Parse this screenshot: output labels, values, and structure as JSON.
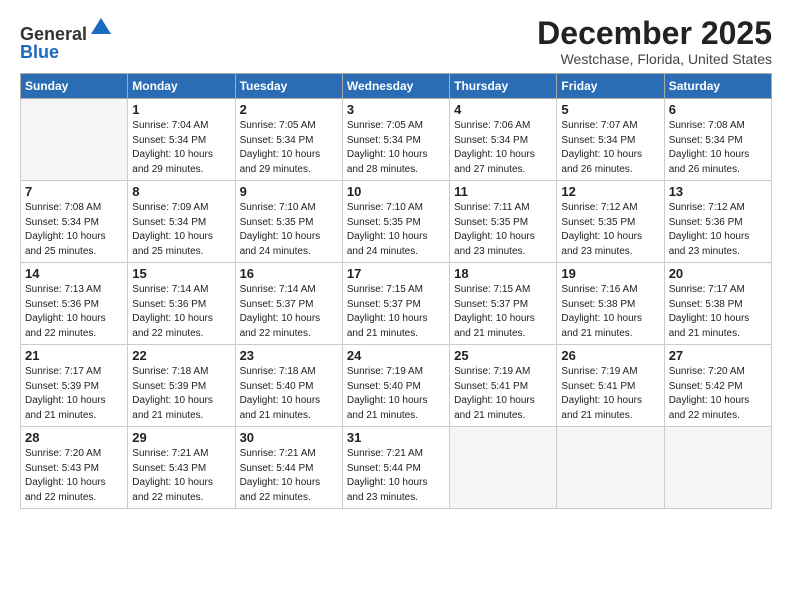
{
  "logo": {
    "general": "General",
    "blue": "Blue"
  },
  "header": {
    "month": "December 2025",
    "location": "Westchase, Florida, United States"
  },
  "weekdays": [
    "Sunday",
    "Monday",
    "Tuesday",
    "Wednesday",
    "Thursday",
    "Friday",
    "Saturday"
  ],
  "weeks": [
    [
      {
        "day": "",
        "empty": true
      },
      {
        "day": "1",
        "sunrise": "7:04 AM",
        "sunset": "5:34 PM",
        "daylight": "10 hours and 29 minutes."
      },
      {
        "day": "2",
        "sunrise": "7:05 AM",
        "sunset": "5:34 PM",
        "daylight": "10 hours and 29 minutes."
      },
      {
        "day": "3",
        "sunrise": "7:05 AM",
        "sunset": "5:34 PM",
        "daylight": "10 hours and 28 minutes."
      },
      {
        "day": "4",
        "sunrise": "7:06 AM",
        "sunset": "5:34 PM",
        "daylight": "10 hours and 27 minutes."
      },
      {
        "day": "5",
        "sunrise": "7:07 AM",
        "sunset": "5:34 PM",
        "daylight": "10 hours and 26 minutes."
      },
      {
        "day": "6",
        "sunrise": "7:08 AM",
        "sunset": "5:34 PM",
        "daylight": "10 hours and 26 minutes."
      }
    ],
    [
      {
        "day": "7",
        "sunrise": "7:08 AM",
        "sunset": "5:34 PM",
        "daylight": "10 hours and 25 minutes."
      },
      {
        "day": "8",
        "sunrise": "7:09 AM",
        "sunset": "5:34 PM",
        "daylight": "10 hours and 25 minutes."
      },
      {
        "day": "9",
        "sunrise": "7:10 AM",
        "sunset": "5:35 PM",
        "daylight": "10 hours and 24 minutes."
      },
      {
        "day": "10",
        "sunrise": "7:10 AM",
        "sunset": "5:35 PM",
        "daylight": "10 hours and 24 minutes."
      },
      {
        "day": "11",
        "sunrise": "7:11 AM",
        "sunset": "5:35 PM",
        "daylight": "10 hours and 23 minutes."
      },
      {
        "day": "12",
        "sunrise": "7:12 AM",
        "sunset": "5:35 PM",
        "daylight": "10 hours and 23 minutes."
      },
      {
        "day": "13",
        "sunrise": "7:12 AM",
        "sunset": "5:36 PM",
        "daylight": "10 hours and 23 minutes."
      }
    ],
    [
      {
        "day": "14",
        "sunrise": "7:13 AM",
        "sunset": "5:36 PM",
        "daylight": "10 hours and 22 minutes."
      },
      {
        "day": "15",
        "sunrise": "7:14 AM",
        "sunset": "5:36 PM",
        "daylight": "10 hours and 22 minutes."
      },
      {
        "day": "16",
        "sunrise": "7:14 AM",
        "sunset": "5:37 PM",
        "daylight": "10 hours and 22 minutes."
      },
      {
        "day": "17",
        "sunrise": "7:15 AM",
        "sunset": "5:37 PM",
        "daylight": "10 hours and 21 minutes."
      },
      {
        "day": "18",
        "sunrise": "7:15 AM",
        "sunset": "5:37 PM",
        "daylight": "10 hours and 21 minutes."
      },
      {
        "day": "19",
        "sunrise": "7:16 AM",
        "sunset": "5:38 PM",
        "daylight": "10 hours and 21 minutes."
      },
      {
        "day": "20",
        "sunrise": "7:17 AM",
        "sunset": "5:38 PM",
        "daylight": "10 hours and 21 minutes."
      }
    ],
    [
      {
        "day": "21",
        "sunrise": "7:17 AM",
        "sunset": "5:39 PM",
        "daylight": "10 hours and 21 minutes."
      },
      {
        "day": "22",
        "sunrise": "7:18 AM",
        "sunset": "5:39 PM",
        "daylight": "10 hours and 21 minutes."
      },
      {
        "day": "23",
        "sunrise": "7:18 AM",
        "sunset": "5:40 PM",
        "daylight": "10 hours and 21 minutes."
      },
      {
        "day": "24",
        "sunrise": "7:19 AM",
        "sunset": "5:40 PM",
        "daylight": "10 hours and 21 minutes."
      },
      {
        "day": "25",
        "sunrise": "7:19 AM",
        "sunset": "5:41 PM",
        "daylight": "10 hours and 21 minutes."
      },
      {
        "day": "26",
        "sunrise": "7:19 AM",
        "sunset": "5:41 PM",
        "daylight": "10 hours and 21 minutes."
      },
      {
        "day": "27",
        "sunrise": "7:20 AM",
        "sunset": "5:42 PM",
        "daylight": "10 hours and 22 minutes."
      }
    ],
    [
      {
        "day": "28",
        "sunrise": "7:20 AM",
        "sunset": "5:43 PM",
        "daylight": "10 hours and 22 minutes."
      },
      {
        "day": "29",
        "sunrise": "7:21 AM",
        "sunset": "5:43 PM",
        "daylight": "10 hours and 22 minutes."
      },
      {
        "day": "30",
        "sunrise": "7:21 AM",
        "sunset": "5:44 PM",
        "daylight": "10 hours and 22 minutes."
      },
      {
        "day": "31",
        "sunrise": "7:21 AM",
        "sunset": "5:44 PM",
        "daylight": "10 hours and 23 minutes."
      },
      {
        "day": "",
        "empty": true
      },
      {
        "day": "",
        "empty": true
      },
      {
        "day": "",
        "empty": true
      }
    ]
  ]
}
